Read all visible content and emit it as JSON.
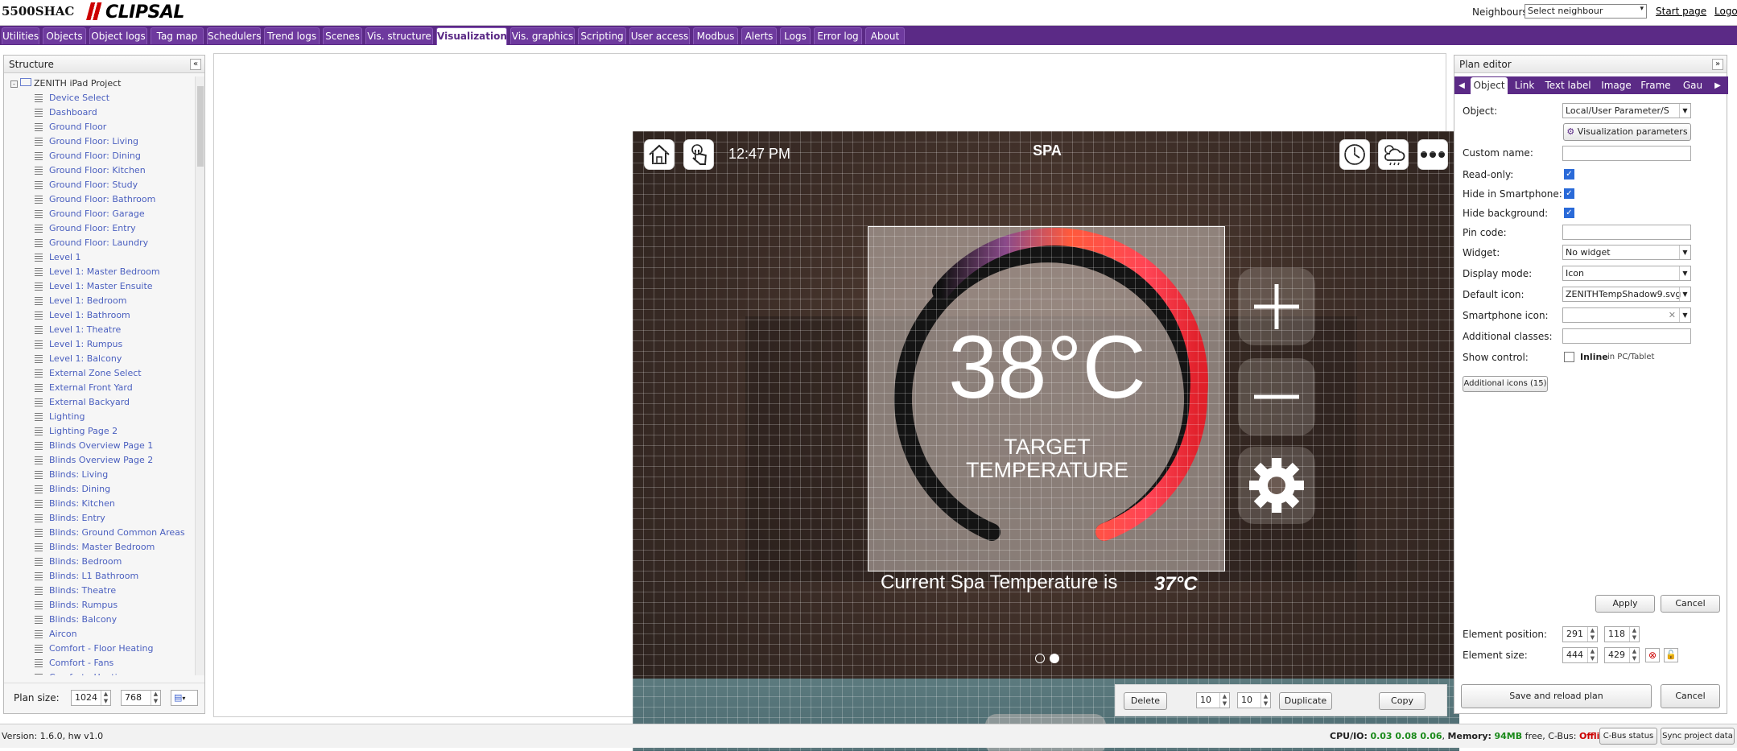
{
  "header": {
    "brand": "5500SHAC",
    "logo_text": "CLIPSAL",
    "neighbours_label": "Neighbours:",
    "neighbour_select": "Select neighbour",
    "start_page": "Start page",
    "logout": "Logout"
  },
  "tabs": [
    "Utilities",
    "Objects",
    "Object logs",
    "Tag map",
    "Schedulers",
    "Trend logs",
    "Scenes",
    "Vis. structure",
    "Visualization",
    "Vis. graphics",
    "Scripting",
    "User access",
    "Modbus",
    "Alerts",
    "Logs",
    "Error log",
    "About"
  ],
  "active_tab": "Visualization",
  "structure": {
    "title": "Structure",
    "root": "ZENITH iPad Project",
    "items": [
      "Device Select",
      "Dashboard",
      "Ground Floor",
      "Ground Floor: Living",
      "Ground Floor: Dining",
      "Ground Floor: Kitchen",
      "Ground Floor: Study",
      "Ground Floor: Bathroom",
      "Ground Floor: Garage",
      "Ground Floor: Entry",
      "Ground Floor: Laundry",
      "Level 1",
      "Level 1: Master Bedroom",
      "Level 1: Master Ensuite",
      "Level 1: Bedroom",
      "Level 1: Bathroom",
      "Level 1: Theatre",
      "Level 1: Rumpus",
      "Level 1: Balcony",
      "External Zone Select",
      "External Front Yard",
      "External Backyard",
      "Lighting",
      "Lighting Page 2",
      "Blinds Overview Page 1",
      "Blinds Overview Page 2",
      "Blinds: Living",
      "Blinds: Dining",
      "Blinds: Kitchen",
      "Blinds: Entry",
      "Blinds: Ground Common Areas",
      "Blinds: Master Bedroom",
      "Blinds: Bedroom",
      "Blinds: L1 Bathroom",
      "Blinds: Theatre",
      "Blinds: Rumpus",
      "Blinds: Balcony",
      "Aircon",
      "Comfort - Floor Heating",
      "Comfort - Fans",
      "Comfort - Heating"
    ],
    "plan_size_label": "Plan size:",
    "plan_width": "1024",
    "plan_height": "768"
  },
  "visualization": {
    "time": "12:47 PM",
    "title": "SPA",
    "temperature": "38°C",
    "target_line1": "TARGET",
    "target_line2": "TEMPERATURE",
    "current_label": "Current Spa Temperature is",
    "current_value": "37°C",
    "menu": "MENU"
  },
  "bottom_tools": {
    "delete": "Delete",
    "x": "10",
    "y": "10",
    "duplicate": "Duplicate",
    "copy": "Copy"
  },
  "editor": {
    "title": "Plan editor",
    "tabs": [
      "Object",
      "Link",
      "Text label",
      "Image",
      "Frame",
      "Gau"
    ],
    "active_tab": "Object",
    "object_label": "Object:",
    "object_value": "Local/User Parameter/S",
    "vis_params": "Visualization parameters",
    "custom_name_label": "Custom name:",
    "readonly_label": "Read-only:",
    "hide_smartphone_label": "Hide in Smartphone:",
    "hide_background_label": "Hide background:",
    "pin_label": "Pin code:",
    "widget_label": "Widget:",
    "widget_value": "No widget",
    "display_mode_label": "Display mode:",
    "display_mode_value": "Icon",
    "default_icon_label": "Default icon:",
    "default_icon_value": "ZENITHTempShadow9.svg",
    "smartphone_icon_label": "Smartphone icon:",
    "additional_classes_label": "Additional classes:",
    "show_control_label": "Show control:",
    "inline_label": "Inline",
    "inline_suffix": "in PC/Tablet",
    "additional_icons": "Additional icons (15)",
    "apply": "Apply",
    "cancel": "Cancel",
    "position_label": "Element position:",
    "pos_x": "291",
    "pos_y": "118",
    "size_label": "Element size:",
    "size_w": "444",
    "size_h": "429",
    "save_reload": "Save and reload plan",
    "cancel2": "Cancel"
  },
  "status": {
    "version": "Version: 1.6.0, hw v1.0",
    "cpu_label": "CPU/IO:",
    "cpu_value": "0.03 0.08 0.06",
    "memory_label": "Memory:",
    "memory_value": "94MB",
    "memory_suffix": "free, C-Bus:",
    "cbus_value": "Offline",
    "cbus_status": "C-Bus status",
    "sync": "Sync project data"
  }
}
